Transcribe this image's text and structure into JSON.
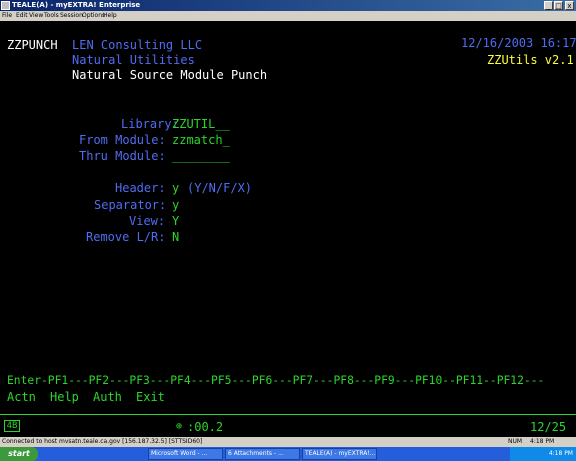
{
  "window": {
    "title": "TEALE(A) - myEXTRA! Enterprise",
    "minimize": "_",
    "maximize": "□",
    "close": "x"
  },
  "menu": [
    "File",
    "Edit",
    "View",
    "Tools",
    "Session",
    "Options",
    "Help"
  ],
  "screen": {
    "program": "ZZPUNCH",
    "company": "LEN Consulting LLC",
    "subsystem": "Natural Utilities",
    "title": "Natural Source Module Punch",
    "datetime": "12/16/2003 16:17",
    "app_name": "ZZUtils v2.1",
    "fields": {
      "library_label": "Library:",
      "library_value": "ZZUTIL",
      "library_fill": "__",
      "from_label": "From Module:",
      "from_value": "zzmatch",
      "from_fill": "_",
      "thru_label": "Thru Module:",
      "thru_value": "________",
      "header_label": "Header:",
      "header_value": "y",
      "header_options": "(Y/N/F/X)",
      "separator_label": "Separator:",
      "separator_value": "y",
      "view_label": "View:",
      "view_value": "Y",
      "remove_label": "Remove L/R:",
      "remove_value": "N"
    },
    "pfkeys_line": "Enter-PF1---PF2---PF3---PF4---PF5---PF6---PF7---PF8---PF9---PF10--PF11--PF12---",
    "pfkey_actions": [
      "Actn",
      "Help",
      "Auth",
      "Exit"
    ]
  },
  "oia": {
    "session": "4B",
    "timer": ":00.2",
    "cursor": "12/25"
  },
  "statusbar": {
    "connection": "Connected to host mvsatn.teale.ca.gov [156.187.32.5] [STTSID60]",
    "mode": "NUM",
    "time": "4:18 PM"
  },
  "taskbar": {
    "start": "start",
    "tasks": [
      "Microsoft Word - ...",
      "6 Attachments - ...",
      "TEALE(A) - myEXTRA!..."
    ],
    "clock": "4:18 PM"
  }
}
